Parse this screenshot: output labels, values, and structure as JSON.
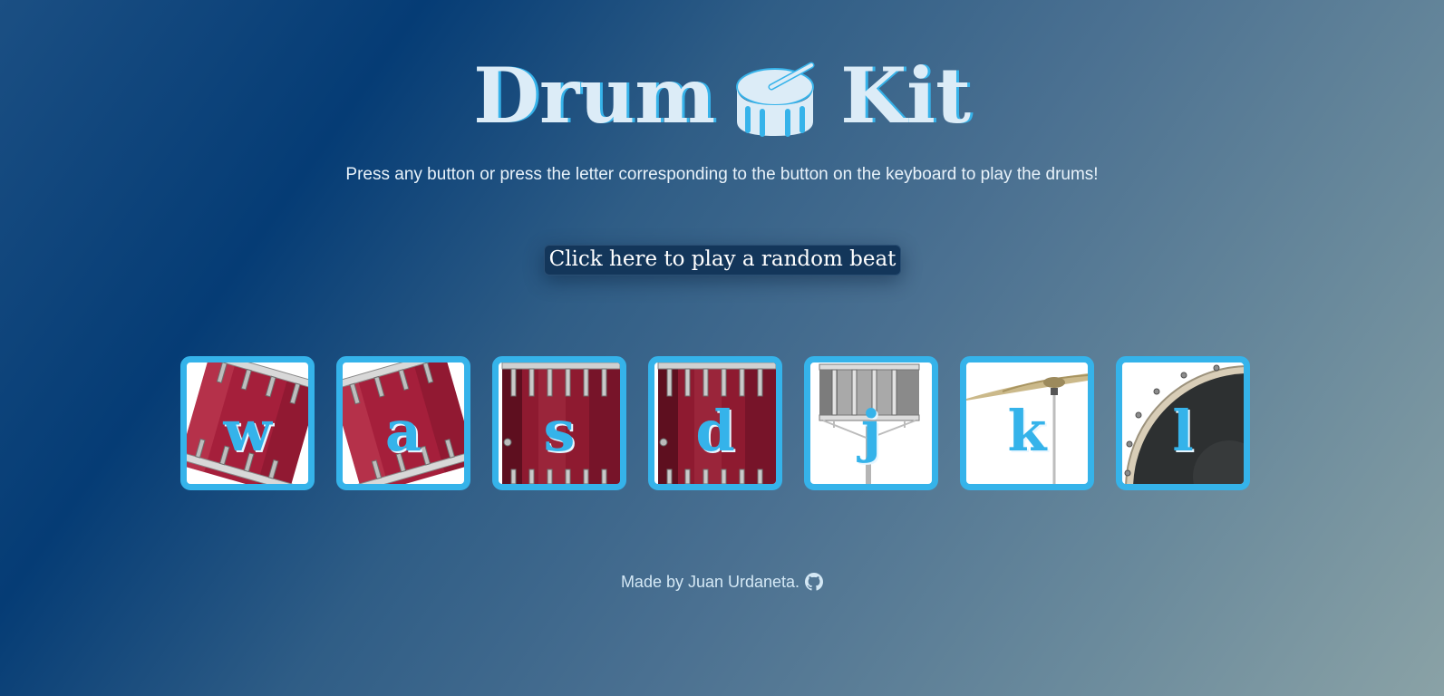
{
  "header": {
    "title_left": "Drum",
    "title_icon": "drum-icon",
    "title_right": "Kit",
    "subtitle": "Press any button or press the letter corresponding to the button on the keyboard to play the drums!"
  },
  "random_button": {
    "label": "Click here to play a random beat"
  },
  "drums": [
    {
      "key": "w",
      "image": "tom-tilted-left"
    },
    {
      "key": "a",
      "image": "tom-tilted-right"
    },
    {
      "key": "s",
      "image": "floor-tom"
    },
    {
      "key": "d",
      "image": "floor-tom"
    },
    {
      "key": "j",
      "image": "snare"
    },
    {
      "key": "k",
      "image": "cymbal"
    },
    {
      "key": "l",
      "image": "bass-drum"
    }
  ],
  "footer": {
    "text": "Made by Juan Urdaneta.",
    "icon": "github-icon"
  },
  "colors": {
    "accent": "#35b3ea",
    "title": "#dcecf7",
    "button_bg": "#13365a",
    "drum_red": "#a0203a",
    "bass_dark": "#2c2f30"
  }
}
